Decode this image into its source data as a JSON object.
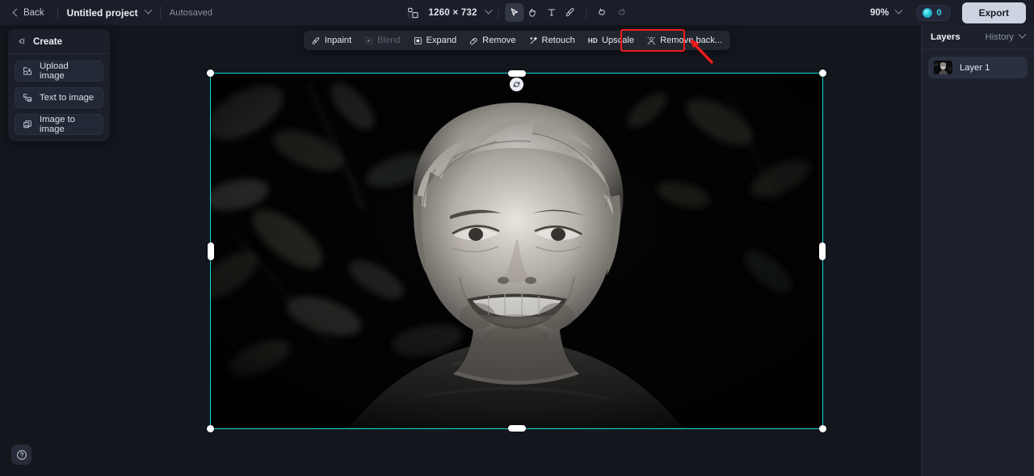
{
  "topbar": {
    "back_label": "Back",
    "project_name": "Untitled project",
    "autosaved_label": "Autosaved",
    "canvas_size": "1260 × 732",
    "zoom_level": "90%",
    "credits_count": "0",
    "export_label": "Export",
    "tools": [
      {
        "name": "select-tool",
        "icon": "cursor-arrow-icon",
        "active": true
      },
      {
        "name": "hand-tool",
        "icon": "hand-icon",
        "active": false
      },
      {
        "name": "text-tool",
        "icon": "text-icon",
        "active": false
      },
      {
        "name": "brush-tool",
        "icon": "brush-icon",
        "active": false
      },
      {
        "name": "undo",
        "icon": "undo-icon",
        "active": false
      },
      {
        "name": "redo",
        "icon": "redo-icon",
        "active": false
      }
    ]
  },
  "create_panel": {
    "title": "Create",
    "items": [
      {
        "label": "Upload image",
        "icon": "upload-image-icon"
      },
      {
        "label": "Text to image",
        "icon": "text-to-image-icon"
      },
      {
        "label": "Image to image",
        "icon": "image-to-image-icon"
      }
    ]
  },
  "action_toolbar": {
    "items": [
      {
        "label": "Inpaint",
        "icon": "inpaint-icon",
        "disabled": false,
        "highlighted": false
      },
      {
        "label": "Blend",
        "icon": "blend-icon",
        "disabled": true,
        "highlighted": false
      },
      {
        "label": "Expand",
        "icon": "expand-icon",
        "disabled": false,
        "highlighted": false
      },
      {
        "label": "Remove",
        "icon": "remove-icon",
        "disabled": false,
        "highlighted": false
      },
      {
        "label": "Retouch",
        "icon": "retouch-icon",
        "disabled": false,
        "highlighted": false
      },
      {
        "label": "Upscale",
        "icon": "hd-icon",
        "disabled": false,
        "highlighted": false
      },
      {
        "label": "Remove back...",
        "icon": "remove-bg-icon",
        "disabled": false,
        "highlighted": true
      }
    ]
  },
  "layers_panel": {
    "tab_layers": "Layers",
    "tab_history": "History",
    "layers": [
      {
        "name": "Layer 1",
        "selected": true
      }
    ]
  },
  "canvas": {
    "image_description": "black-and-white portrait of smiling young man with wavy hair in front of dark foliage",
    "selection_active": true
  },
  "help": {
    "label": "?"
  },
  "colors": {
    "accent_cyan": "#18dad4",
    "annotation_red": "#f21b1b",
    "topbar_bg": "#1b1e28",
    "canvas_bg": "#14161d",
    "panel_bg": "#1d212c",
    "export_bg": "#ccd4e2",
    "credit_text": "#33d6e0"
  }
}
